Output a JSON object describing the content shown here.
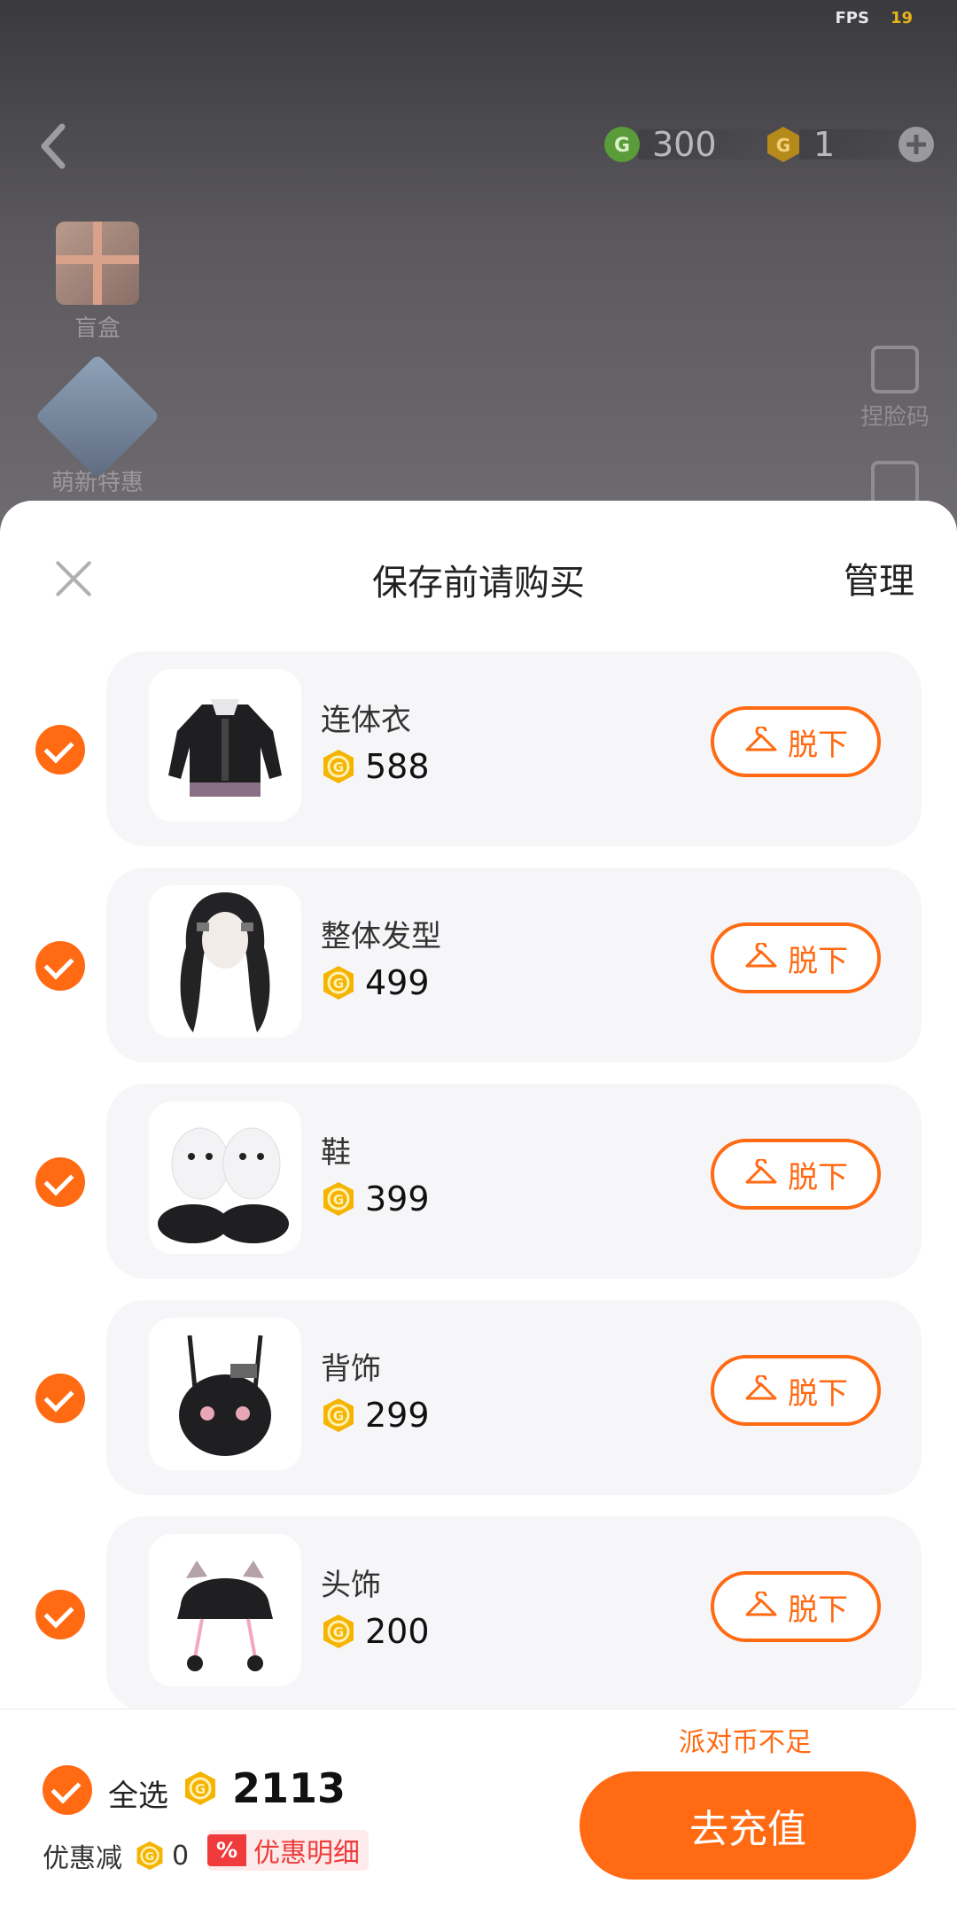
{
  "status": {
    "fps_label": "FPS",
    "fps_value": "19"
  },
  "header": {
    "currency_green": "300",
    "currency_gold": "1"
  },
  "left_menu": [
    {
      "label": "盲盒",
      "icon": "gift-box-icon"
    },
    {
      "label": "萌新特惠",
      "icon": "promo-icon"
    }
  ],
  "right_menu": [
    {
      "label": "捏脸码",
      "icon": "edit-icon"
    }
  ],
  "sheet": {
    "title": "保存前请购买",
    "manage": "管理",
    "off_label": "脱下"
  },
  "items": [
    {
      "name": "连体衣",
      "price": "588",
      "checked": true
    },
    {
      "name": "整体发型",
      "price": "499",
      "checked": true
    },
    {
      "name": "鞋",
      "price": "399",
      "checked": true
    },
    {
      "name": "背饰",
      "price": "299",
      "checked": true
    },
    {
      "name": "头饰",
      "price": "200",
      "checked": true
    }
  ],
  "footer": {
    "warning": "派对币不足",
    "select_all": "全选",
    "total": "2113",
    "discount_label": "优惠减",
    "discount_value": "0",
    "discount_tag": "%",
    "discount_detail": "优惠明细",
    "recharge": "去充值"
  },
  "colors": {
    "accent": "#ff6a13",
    "coin": "#f5b400",
    "green_coin": "#4caf50"
  }
}
